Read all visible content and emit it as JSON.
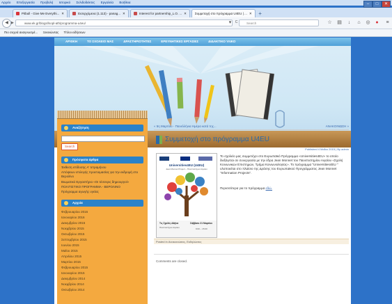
{
  "menubar": {
    "items": [
      "Αρχείο",
      "Επεξεργασία",
      "Προβολή",
      "Ιστορικό",
      "Σελιδοδείκτες",
      "Εργαλεία",
      "Βοήθεια"
    ]
  },
  "tabs": [
    {
      "label": "Pitbull - Give Me Everythi...",
      "color": "#d9343a"
    },
    {
      "label": "Εισερχόμενα (1.113) - panag...",
      "color": "#c74b4b"
    },
    {
      "label": "Interest for partnership_L.O. ...",
      "color": "#c74b4b"
    },
    {
      "label": "Συμμετοχή στο πρόγραμμα U4EU | ...",
      "color": "#2a82c9"
    }
  ],
  "nav": {
    "url": "www.ek.gr/blogs/lsopl-ath/programma-u4eu/",
    "search_placeholder": "Search",
    "reload_label": "C"
  },
  "bookmarks": [
    "Πιο συχνά αναγνωσμέ...",
    "Ξεκινώντας",
    "Τίτλοι ειδήσεων"
  ],
  "site": {
    "menu": [
      "ΑΡΧΙΚΗ",
      "ΤΟ ΣΧΟΛΕΙΟ ΜΑΣ",
      "ΔΡΑΣΤΗΡΙΟΤΗΤΕΣ",
      "ΕΡΕΥΝΗΤΙΚΕΣ ΕΡΓΑΣΙΕΣ",
      "ΔΙΔΑΚΤΙΚΟ ΥΛΙΚΟ"
    ],
    "sidebar": {
      "search_title": "Αναζήτηση",
      "search_button": "Search",
      "recent_title": "Πρόσφατα άρθρα",
      "recent": [
        "Έκθεση επίδοσης Α' τετραμήνου",
        "Απόψεων επιλογής προετοιμασίας για την εκδρομή στο Βερολίνο",
        "Βιωματικό Εργαστήριο «Οι τέσσερις δημιουργοί»",
        "ΠΟΛΙΤΙΣΤΙΚΟ ΠΡΟΓΡΑΜΜΑ - ΒΕΡΟΛΙΝΟ",
        "Πρόγραμμα αγωγής υγείας"
      ],
      "archive_title": "Αρχεία",
      "archive": [
        "Φεβρουαρίου 2016",
        "Ιανουαρίου 2016",
        "Δεκεμβρίου 2015",
        "Νοεμβρίου 2015",
        "Οκτωβρίου 2015",
        "Σεπτεμβρίου 2015",
        "Ιουνίου 2015",
        "Μαΐου 2015",
        "Απριλίου 2015",
        "Μαρτίου 2015",
        "Φεβρουαρίου 2015",
        "Ιανουαρίου 2015",
        "Δεκεμβρίου 2014",
        "Νοεμβρίου 2014",
        "Οκτωβρίου 2014"
      ]
    },
    "post": {
      "prev_link": "« 5η Μαρτίου - Πανελλήνια Ημέρα κατά της...",
      "next_link": "ΑΝΑΚΟΙΝΩΣΗ »",
      "title": "Συμμετοχή στο πρόγραμμα U4EU",
      "meta": "Published 4 Μαΐου 2015 | By admin",
      "body": "Το σχολείο μας συμμετέχει στο Ευρωπαϊκό Πρόγραμμα «Universities4EU» το οποίο διεξάγεται σε συνεργασία με την έδρα Jean Monnet του Πανεπιστημίου Αιγαίου «Σχολή Κοινωνικών Επιστημών, Τμήμα Κοινωνιολογίας». Το πρόγραμμα \"Universities4EU \" υλοποιείται στο πλαίσιο της Δράσης του Ευρωπαϊκού Προγράμματος Jean Monnet \"Information Projects\".",
      "more_prefix": "Περισσότερα για το πρόγραμμα ",
      "more_link": "εδώ.",
      "poster": {
        "title": "Universities4EU (U4EU)",
        "subtitle": "Jean Monnet Project – Πανεπιστήμιο Αιγαίου",
        "left_label": "Τις Σχολές Αθήνα",
        "left_sub": "Πανεπιστήμιο Αιγαίου",
        "right_label": "Σάββατο 21 Μαρτίου",
        "right_time": "9:00 – 15:00"
      },
      "footer": "Posted in Ανακοινώσεις, Εκδηλώσεις",
      "comments": "Comments are closed."
    }
  },
  "colors": {
    "accent": "#2a82c9",
    "sidebar": "#f4a93f",
    "page_bg": "#2d72c8"
  }
}
